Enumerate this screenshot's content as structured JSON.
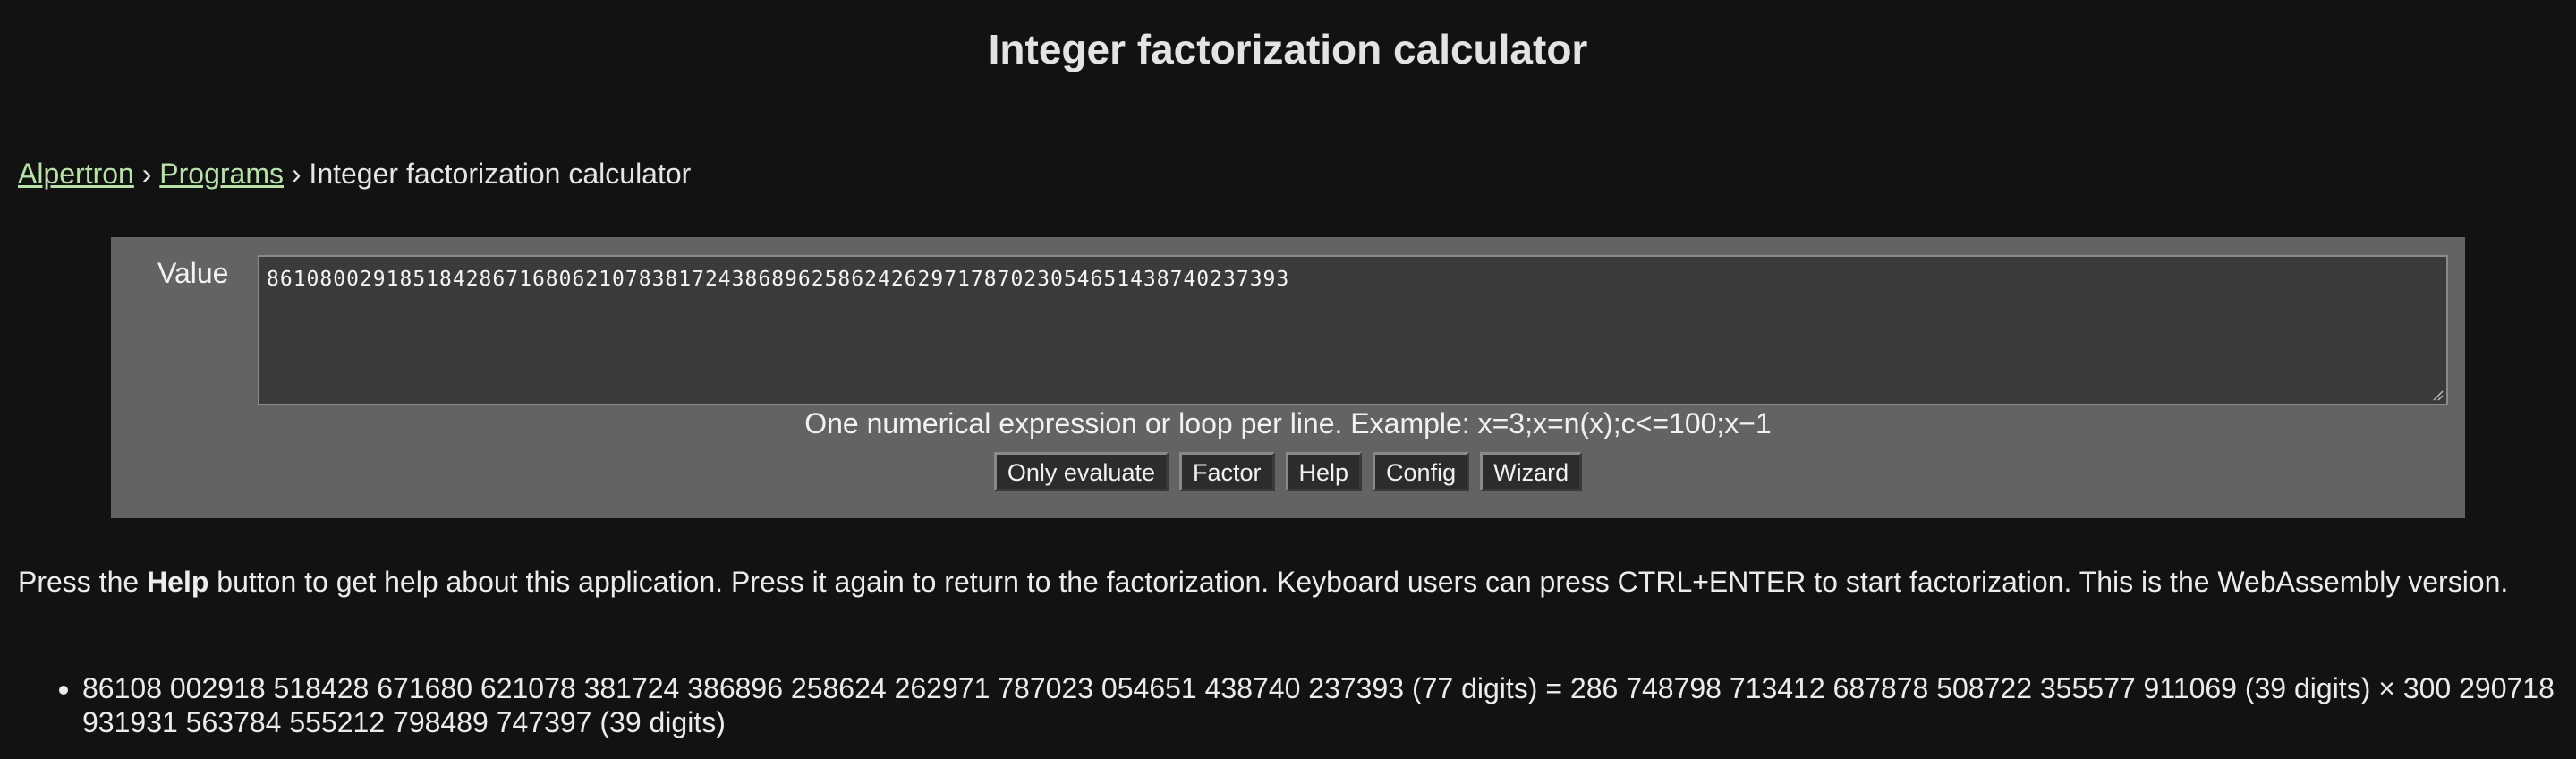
{
  "page": {
    "title": "Integer factorization calculator"
  },
  "breadcrumb": {
    "home_link": "Alpertron",
    "separator_1": "›",
    "programs_link": "Programs",
    "separator_2": "›",
    "current": "Integer factorization calculator"
  },
  "form": {
    "value_label": "Value",
    "value": "86108002918518428671680621078381724386896258624262971787023054651438740237393",
    "hint": "One numerical expression or loop per line. Example: x=3;x=n(x);c<=100;x−1",
    "buttons": {
      "only_evaluate": "Only evaluate",
      "factor": "Factor",
      "help": "Help",
      "config": "Config",
      "wizard": "Wizard"
    }
  },
  "help_text": {
    "before_bold": "Press the ",
    "bold": "Help",
    "after_bold": " button to get help about this application. Press it again to return to the factorization. Keyboard users can press CTRL+ENTER to start factorization. This is the WebAssembly version."
  },
  "results": [
    {
      "line_1": "86108 002918 518428 671680 621078 381724 386896 258624 262971 787023 054651 438740 237393 (77 digits) = 286 748798 713412 687878 508722 355577 911069 (39 digits) × 300 290718",
      "line_2": "931931 563784 555212 798489 747397 (39 digits)"
    }
  ],
  "colors": {
    "background": "#121212",
    "panel": "#636363",
    "link": "#b6e4a4",
    "textarea_bg": "#3b3b3b"
  },
  "icons": {
    "resize_handle": "resize-grip-icon"
  }
}
